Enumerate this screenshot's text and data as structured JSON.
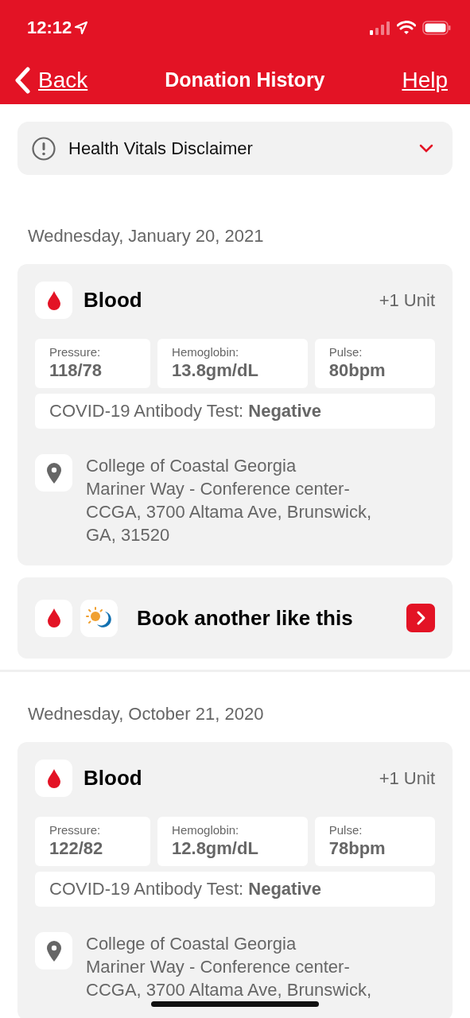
{
  "status_bar": {
    "time": "12:12"
  },
  "nav": {
    "back": "Back",
    "title": "Donation History",
    "help": "Help"
  },
  "disclaimer": {
    "title": "Health Vitals Disclaimer",
    "expanded": false
  },
  "donations": [
    {
      "date": "Wednesday, January 20, 2021",
      "type": "Blood",
      "units": "+1 Unit",
      "vitals": [
        {
          "label": "Pressure:",
          "value": "118/78"
        },
        {
          "label": "Hemoglobin:",
          "value": "13.8gm/dL"
        },
        {
          "label": "Pulse:",
          "value": "80bpm"
        }
      ],
      "antibody": "COVID-19 Antibody Test: **Negative**",
      "address": [
        "College of Coastal Georgia",
        "Mariner Way - Conference center-",
        "CCGA, 3700 Altama Ave, Brunswick,",
        "GA, 31520"
      ],
      "book": "Book another like this"
    },
    {
      "date": "Wednesday, October 21, 2020",
      "type": "Blood",
      "units": "+1 Unit",
      "vitals": [
        {
          "label": "Pressure:",
          "value": "122/82"
        },
        {
          "label": "Hemoglobin:",
          "value": "12.8gm/dL"
        },
        {
          "label": "Pulse:",
          "value": "78bpm"
        }
      ],
      "antibody": "COVID-19 Antibody Test: **Negative**",
      "address": [
        "College of Coastal Georgia",
        "Mariner Way - Conference center-",
        "CCGA, 3700 Altama Ave, Brunswick,"
      ]
    }
  ]
}
